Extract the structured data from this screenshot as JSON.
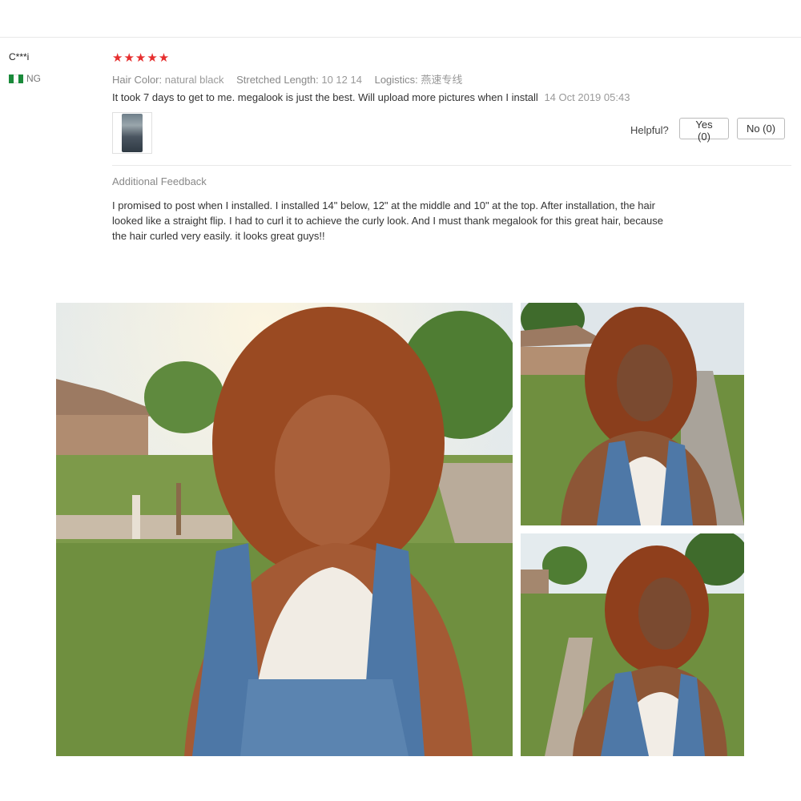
{
  "review": {
    "user": "C***i",
    "country": "NG",
    "stars": "★★★★★",
    "attributes": [
      {
        "key": "Hair Color:",
        "value": "natural black"
      },
      {
        "key": "Stretched Length:",
        "value": "10 12 14"
      },
      {
        "key": "Logistics:",
        "value": "燕速专线"
      }
    ],
    "comment": "It took 7 days to get to me. megalook is just the best. Will upload more pictures when I install",
    "date": "14 Oct 2019 05:43",
    "helpful_label": "Helpful?",
    "yes_label": "Yes (0)",
    "no_label": "No (0)"
  },
  "additional": {
    "title": "Additional Feedback",
    "text": "I promised to post when I installed. I installed 14\" below, 12\" at the middle and 10\" at the top. After installation, the hair looked like a straight flip. I had to curl it to achieve the curly look. And I must thank megalook for this great hair, because the hair curled very easily. it looks great guys!!"
  },
  "colors": {
    "star": "#e62e2e",
    "flag_green": "#1a8a3a"
  }
}
